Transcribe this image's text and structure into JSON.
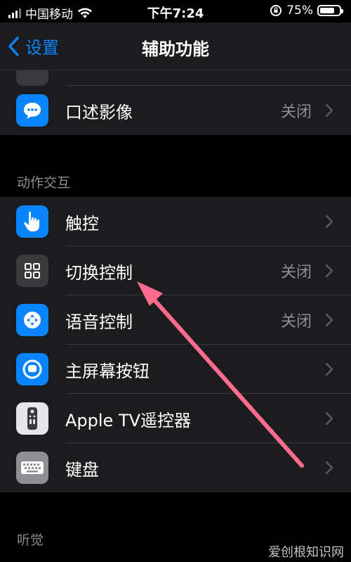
{
  "status_bar": {
    "carrier": "中国移动",
    "time": "下午7:24",
    "battery": "75%",
    "battery_level": 0.75,
    "icons": [
      "signal-icon",
      "wifi-icon",
      "orientation-lock-icon",
      "battery-icon"
    ]
  },
  "nav": {
    "back_label": "设置",
    "title": "辅助功能"
  },
  "top_group": {
    "items": [
      {
        "label": "口述影像",
        "value": "关闭",
        "icon": "speech-bubble-icon",
        "color": "#0a84ff"
      }
    ]
  },
  "interaction_section": {
    "header": "动作交互",
    "items": [
      {
        "label": "触控",
        "value": "",
        "icon": "hand-pointer-icon",
        "color": "#0a84ff"
      },
      {
        "label": "切换控制",
        "value": "关闭",
        "icon": "grid-icon",
        "color": "#3a3a3c"
      },
      {
        "label": "语音控制",
        "value": "关闭",
        "icon": "voice-control-icon",
        "color": "#0a84ff"
      },
      {
        "label": "主屏幕按钮",
        "value": "",
        "icon": "home-button-icon",
        "color": "#0a84ff"
      },
      {
        "label": "Apple TV遥控器",
        "value": "",
        "icon": "remote-icon",
        "color": "#8e8e93"
      },
      {
        "label": "键盘",
        "value": "",
        "icon": "keyboard-icon",
        "color": "#8e8e93"
      }
    ]
  },
  "hearing_section": {
    "header": "听觉"
  },
  "watermark": "爱创根知识网",
  "colors": {
    "accent": "#0a84ff",
    "annotation_arrow": "#ff6b8f"
  }
}
